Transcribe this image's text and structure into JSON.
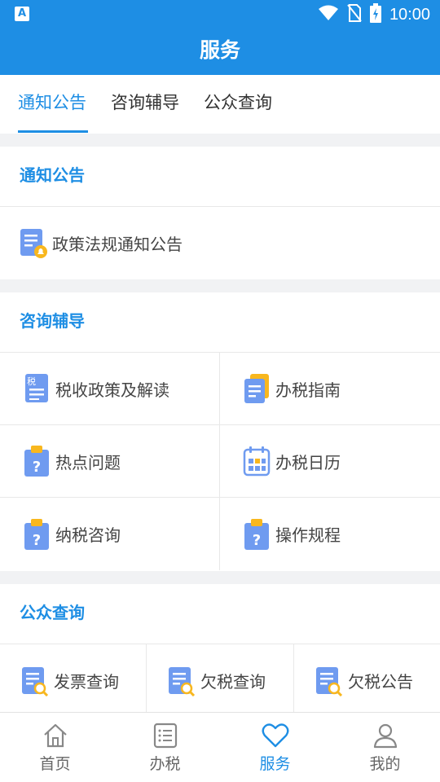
{
  "status_bar": {
    "time": "10:00",
    "app_icon_letter": "A"
  },
  "header": {
    "title": "服务"
  },
  "tabs": [
    {
      "label": "通知公告",
      "active": true
    },
    {
      "label": "咨询辅导",
      "active": false
    },
    {
      "label": "公众查询",
      "active": false
    }
  ],
  "sections": {
    "notice": {
      "title": "通知公告",
      "items": [
        {
          "label": "政策法规通知公告",
          "icon": "document-bell-icon"
        }
      ]
    },
    "consult": {
      "title": "咨询辅导",
      "items": [
        {
          "label": "税收政策及解读",
          "icon": "tax-document-icon",
          "icon_text": "税"
        },
        {
          "label": "办税指南",
          "icon": "guide-document-icon"
        },
        {
          "label": "热点问题",
          "icon": "question-clipboard-icon"
        },
        {
          "label": "办税日历",
          "icon": "calendar-icon"
        },
        {
          "label": "纳税咨询",
          "icon": "question-clipboard-icon"
        },
        {
          "label": "操作规程",
          "icon": "question-clipboard-icon"
        }
      ]
    },
    "query": {
      "title": "公众查询",
      "items": [
        {
          "label": "发票查询",
          "icon": "document-search-icon"
        },
        {
          "label": "欠税查询",
          "icon": "document-search-icon"
        },
        {
          "label": "欠税公告",
          "icon": "document-search-icon"
        }
      ]
    }
  },
  "bottom_nav": [
    {
      "label": "首页",
      "icon": "home-icon",
      "active": false
    },
    {
      "label": "办税",
      "icon": "list-icon",
      "active": false
    },
    {
      "label": "服务",
      "icon": "heart-icon",
      "active": true
    },
    {
      "label": "我的",
      "icon": "user-icon",
      "active": false
    }
  ],
  "colors": {
    "primary": "#1e8ee4",
    "icon_blue": "#6f9bf0",
    "icon_yellow": "#f8b71e",
    "background": "#f1f2f4"
  }
}
